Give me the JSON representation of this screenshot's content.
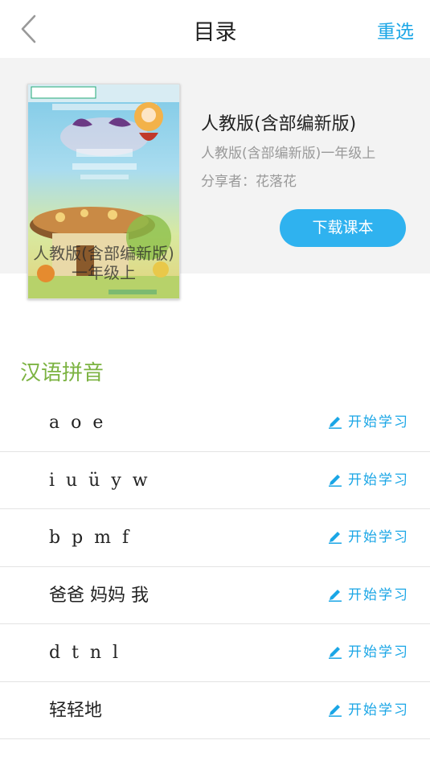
{
  "header": {
    "title": "目录",
    "reselect_label": "重选"
  },
  "book": {
    "cover_overlay_line1": "人教版(含部编新版)",
    "cover_overlay_line2": "一年级上",
    "name": "人教版(含部编新版)",
    "subtitle": "人教版(含部编新版)一年级上",
    "sharer": "分享者：花落花",
    "download_label": "下载课本"
  },
  "section": {
    "title": "汉语拼音"
  },
  "lessons": [
    {
      "name": "a  o  e",
      "action": "开始学习"
    },
    {
      "name": "i  u  ü  y  w",
      "action": "开始学习"
    },
    {
      "name": "b  p  m  f",
      "action": "开始学习"
    },
    {
      "name": "爸爸 妈妈 我",
      "action": "开始学习"
    },
    {
      "name": "d  t  n  l",
      "action": "开始学习"
    },
    {
      "name": "轻轻地",
      "action": "开始学习"
    }
  ],
  "colors": {
    "accent": "#1aa6e6",
    "button": "#2fb2ef",
    "section": "#7cb342"
  }
}
